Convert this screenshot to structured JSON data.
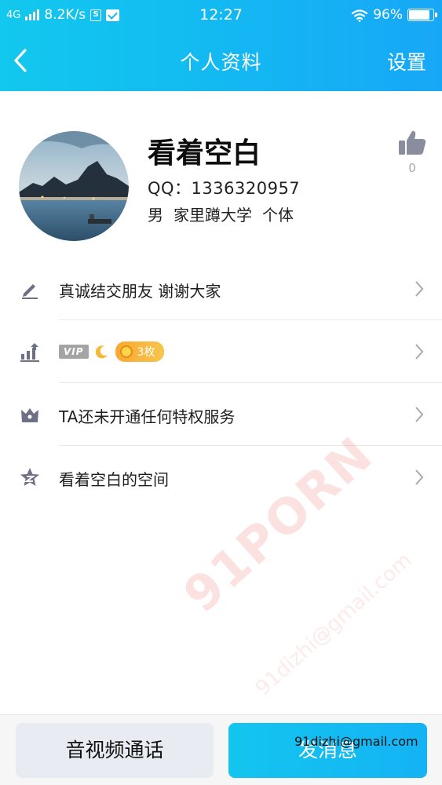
{
  "status_bar": {
    "network": "4G",
    "speed": "8.2K/s",
    "time": "12:27",
    "battery": "96%",
    "sim_badge": "S"
  },
  "nav": {
    "title": "个人资料",
    "settings_label": "设置",
    "back_icon": "chevron-left-icon"
  },
  "profile": {
    "nickname": "看着空白",
    "qq": "QQ：1336320957",
    "gender": "男",
    "school": "家里蹲大学",
    "occupation": "个体",
    "like_count": "0"
  },
  "list": {
    "signature": "真诚结交朋友 谢谢大家",
    "vip_tag": "VIP",
    "coin_count": "3枚",
    "privilege": "TA还未开通任何特权服务",
    "space": "看着空白的空间"
  },
  "watermark": {
    "brand": "91PORN",
    "email": "91dizhi@gmail.com"
  },
  "bottom": {
    "call_label": "音视频通话",
    "send_label": "发消息",
    "overlay_email": "91dizhi@gmail.com"
  },
  "colors": {
    "accent": "#13B9F2",
    "coin": "#F7B13A"
  }
}
